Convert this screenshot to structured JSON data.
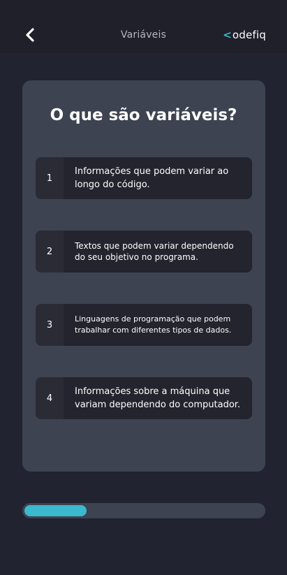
{
  "header": {
    "title": "Variáveis",
    "back_icon": "chevron-left-icon",
    "logo": {
      "bracket": "<",
      "text": "odefiq"
    }
  },
  "quiz": {
    "question": "O que são variáveis?",
    "options": [
      {
        "number": "1",
        "text": "Informações que podem variar ao longo do código."
      },
      {
        "number": "2",
        "text": "Textos que podem variar dependendo do seu objetivo no programa."
      },
      {
        "number": "3",
        "text": "Linguagens de programação que podem trabalhar com diferentes tipos de dados."
      },
      {
        "number": "4",
        "text": "Informações sobre a máquina que variam dependendo do computador."
      }
    ]
  },
  "progress": {
    "fraction": 0.26
  },
  "colors": {
    "background": "#222330",
    "header_background": "#1f2029",
    "card": "#3d4350",
    "option_background": "#23242d",
    "accent": "#3bb9cd"
  }
}
